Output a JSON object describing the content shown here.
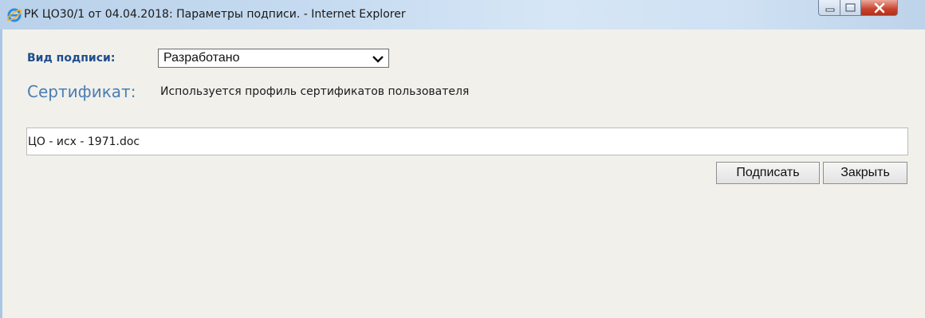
{
  "window": {
    "title": "РК ЦО30/1 от 04.04.2018: Параметры подписи. - Internet Explorer",
    "controls": {
      "minimize_icon": "minimize-icon",
      "maximize_icon": "maximize-icon",
      "close_icon": "close-icon"
    }
  },
  "form": {
    "signature_type_label": "Вид подписи:",
    "signature_type_value": "Разработано",
    "certificate_label": "Сертификат:",
    "certificate_value": "Используется профиль сертификатов пользователя",
    "document_name": "ЦО - исх - 1971.doc"
  },
  "buttons": {
    "sign_label": "Подписать",
    "close_label": "Закрыть"
  },
  "colors": {
    "label_blue": "#1f4e8c",
    "cert_label": "#4a7db3",
    "background": "#f1f0eb"
  }
}
